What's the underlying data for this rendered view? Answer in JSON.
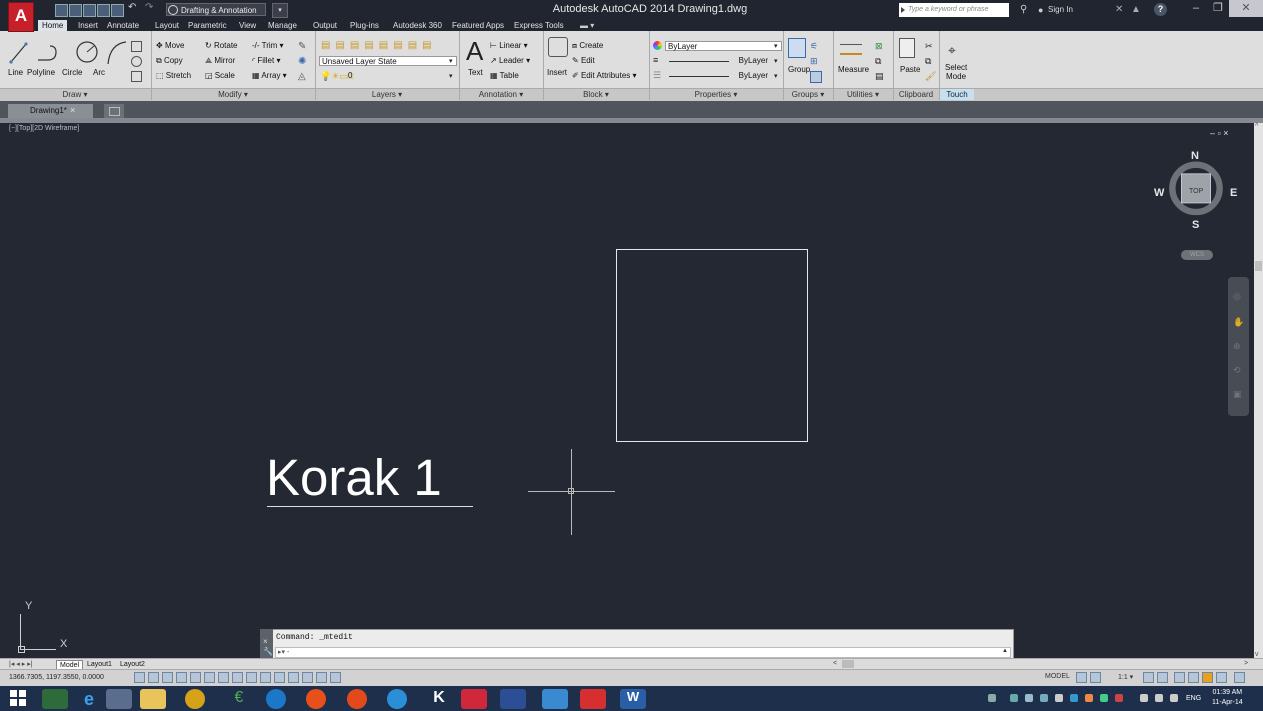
{
  "window": {
    "title": "Autodesk AutoCAD 2014    Drawing1.dwg",
    "workspace": "Drafting & Annotation",
    "search_placeholder": "Type a keyword or phrase",
    "sign_in": "Sign In",
    "help": "?",
    "logo": "A"
  },
  "ribbon_tabs": [
    "Home",
    "Insert",
    "Annotate",
    "Layout",
    "Parametric",
    "View",
    "Manage",
    "Output",
    "Plug-ins",
    "Autodesk 360",
    "Featured Apps",
    "Express Tools"
  ],
  "ribbon": {
    "draw": {
      "panel": "Draw ▾",
      "line": "Line",
      "polyline": "Polyline",
      "circle": "Circle",
      "arc": "Arc"
    },
    "modify": {
      "panel": "Modify ▾",
      "move": "Move",
      "rotate": "Rotate",
      "trim": "Trim ▾",
      "copy": "Copy",
      "mirror": "Mirror",
      "fillet": "Fillet ▾",
      "stretch": "Stretch",
      "scale": "Scale",
      "array": "Array ▾"
    },
    "layers": {
      "panel": "Layers ▾",
      "layer_state": "Unsaved Layer State",
      "current_layer": "0"
    },
    "annotation": {
      "panel": "Annotation ▾",
      "text": "Text",
      "linear": "Linear ▾",
      "leader": "Leader ▾",
      "table": "Table"
    },
    "block": {
      "panel": "Block ▾",
      "insert": "Insert",
      "create": "Create",
      "edit": "Edit",
      "edit_attributes": "Edit Attributes ▾"
    },
    "properties": {
      "panel": "Properties ▾",
      "color": "ByLayer",
      "lineweight": "ByLayer",
      "linetype": "ByLayer"
    },
    "groups": {
      "panel": "Groups ▾",
      "group": "Group"
    },
    "utilities": {
      "panel": "Utilities ▾",
      "measure": "Measure"
    },
    "clipboard": {
      "panel": "Clipboard",
      "paste": "Paste"
    },
    "touch": {
      "panel": "Touch",
      "select_mode": "Select",
      "select_mode2": "Mode"
    }
  },
  "file_tab": {
    "label": "Drawing1*",
    "close": "×"
  },
  "viewport": {
    "label": "[−][Top][2D Wireframe]",
    "controls": "– ▫ ×",
    "text_object": "Korak 1",
    "ucs_y": "Y",
    "ucs_x": "X"
  },
  "viewcube": {
    "n": "N",
    "s": "S",
    "e": "E",
    "w": "W",
    "top": "TOP",
    "wcs": "WCS"
  },
  "command_line": {
    "history": "Command: _mtedit",
    "prompt": "▸▾ -"
  },
  "layout_tabs": [
    "Model",
    "Layout1",
    "Layout2"
  ],
  "status": {
    "coords": "1366.7305, 1197.3550, 0.0000",
    "model": "MODEL",
    "scale": "1:1 ▾"
  },
  "taskbar": {
    "time": "01:39 AM",
    "date": "11-Apr-14",
    "lang": "ENG"
  },
  "colors": {
    "accent_red": "#c8202a",
    "canvas": "#232833",
    "ribbon": "#dedede",
    "taskbar": "#1d2f4b"
  }
}
